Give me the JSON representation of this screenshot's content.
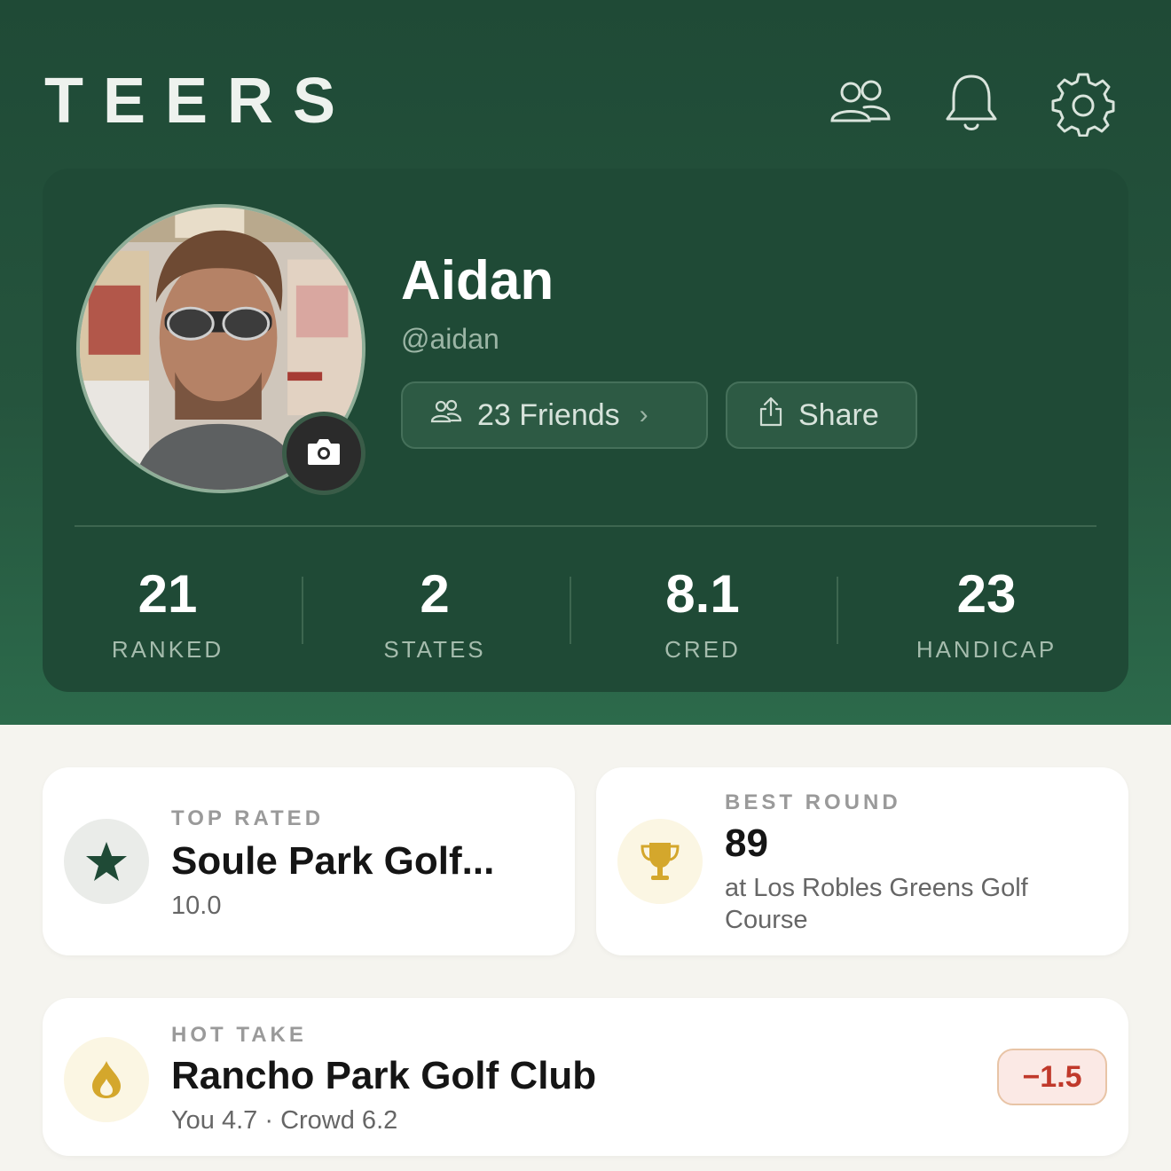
{
  "app": {
    "brand": "TEERS"
  },
  "header_icons": [
    "friends-icon",
    "bell-icon",
    "settings-gear-icon"
  ],
  "profile": {
    "name": "Aidan",
    "handle": "@aidan",
    "friends_label": "23 Friends",
    "share_label": "Share"
  },
  "stats": [
    {
      "value": "21",
      "label": "RANKED"
    },
    {
      "value": "2",
      "label": "STATES"
    },
    {
      "value": "8.1",
      "label": "CRED"
    },
    {
      "value": "23",
      "label": "HANDICAP"
    }
  ],
  "top_rated": {
    "kicker": "TOP RATED",
    "title": "Soule Park Golf...",
    "score": "10.0"
  },
  "best_round": {
    "kicker": "BEST ROUND",
    "score": "89",
    "course_line1": "at Los Robles Greens Golf",
    "course_line2": "Course"
  },
  "hot_take": {
    "kicker": "HOT TAKE",
    "title": "Rancho Park Golf Club",
    "detail": "You 4.7 · Crowd 6.2",
    "delta": "−1.5"
  },
  "colors": {
    "brand_green": "#1f4a36",
    "accent_gold": "#d4a72c",
    "delta_red": "#c0392b"
  }
}
